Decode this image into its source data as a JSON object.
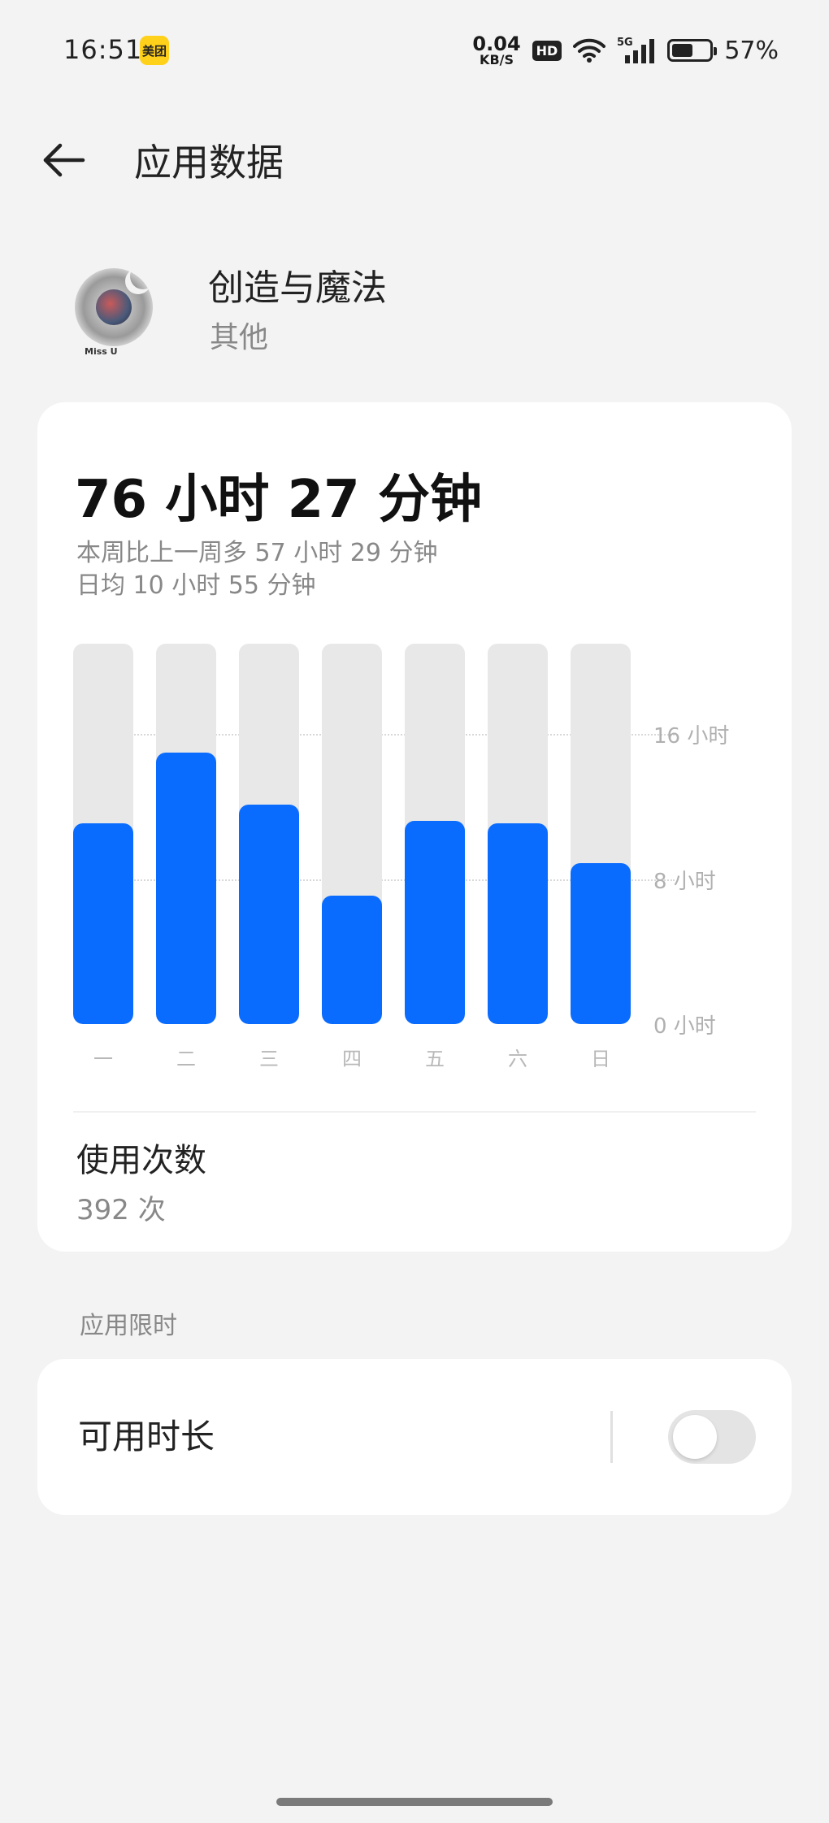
{
  "status_bar": {
    "time": "16:51",
    "app_badge": "美团",
    "net_speed_value": "0.04",
    "net_speed_unit": "KB/S",
    "hd": "HD",
    "signal_label": "5G",
    "battery_percent": "57%",
    "battery_level": 0.57
  },
  "header": {
    "back_icon": "arrow-left-icon",
    "title": "应用数据"
  },
  "app": {
    "name": "创造与魔法",
    "category": "其他",
    "icon_caption": "Miss U"
  },
  "usage": {
    "total": "76 小时 27 分钟",
    "week_compare": "本周比上一周多 57 小时 29 分钟",
    "daily_avg": "日均 10 小时 55 分钟",
    "open_count_label": "使用次数",
    "open_count_value": "392 次"
  },
  "chart_data": {
    "type": "bar",
    "categories": [
      "一",
      "二",
      "三",
      "四",
      "五",
      "六",
      "日"
    ],
    "values": [
      11.1,
      15.0,
      12.1,
      7.1,
      11.2,
      11.1,
      8.9
    ],
    "ylim": [
      0,
      21
    ],
    "y_ticks": [
      {
        "value": 0,
        "label": "0 小时"
      },
      {
        "value": 8,
        "label": "8 小时"
      },
      {
        "value": 16,
        "label": "16 小时"
      }
    ],
    "bar_color": "#0a6cff",
    "track_color": "#e8e8e8",
    "grid": true
  },
  "limits": {
    "section_label": "应用限时",
    "available_duration_label": "可用时长",
    "toggle_on": false
  },
  "colors": {
    "accent": "#0a6cff",
    "background": "#f3f3f3"
  }
}
